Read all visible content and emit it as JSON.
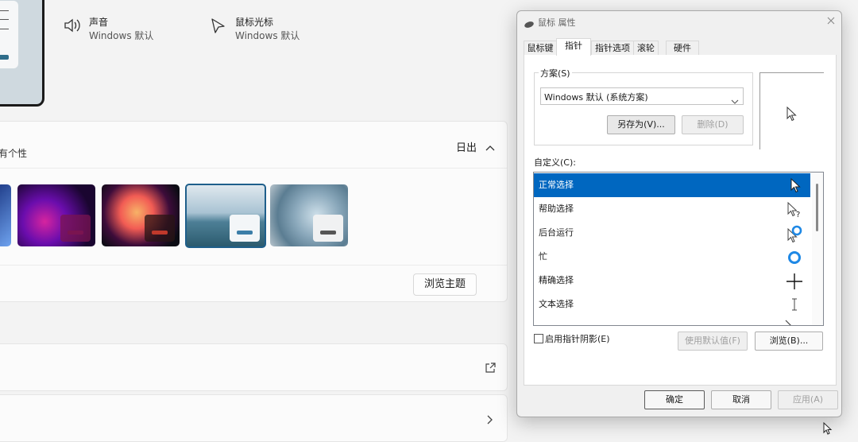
{
  "top": {
    "partial_text_left": "",
    "partial_text_right": "",
    "sound": {
      "title": "声音",
      "value": "Windows 默认"
    },
    "cursor": {
      "title": "鼠标光标",
      "value": "Windows 默认"
    }
  },
  "themes_card": {
    "desc": "有个性",
    "action": "日出",
    "browse_button": "浏览主题"
  },
  "colors": {
    "accent_blue": "#0067c0",
    "red_chip": "#c0392b"
  },
  "dialog": {
    "title": "鼠标 属性",
    "tabs": [
      "鼠标键",
      "指针",
      "指针选项",
      "滚轮",
      "硬件"
    ],
    "scheme_label": "方案(S)",
    "scheme_value": "Windows 默认 (系统方案)",
    "save_as": "另存为(V)...",
    "delete": "删除(D)",
    "customize_label": "自定义(C):",
    "cursors": [
      {
        "label": "正常选择",
        "icon": "arrow-cursor-icon"
      },
      {
        "label": "帮助选择",
        "icon": "help-cursor-icon"
      },
      {
        "label": "后台运行",
        "icon": "working-in-background-cursor-icon"
      },
      {
        "label": "忙",
        "icon": "busy-cursor-icon"
      },
      {
        "label": "精确选择",
        "icon": "precision-cursor-icon"
      },
      {
        "label": "文本选择",
        "icon": "text-cursor-icon"
      }
    ],
    "shadow_label": "启用指针阴影(E)",
    "use_default": "使用默认值(F)",
    "browse": "浏览(B)...",
    "ok": "确定",
    "cancel": "取消",
    "apply": "应用(A)"
  }
}
